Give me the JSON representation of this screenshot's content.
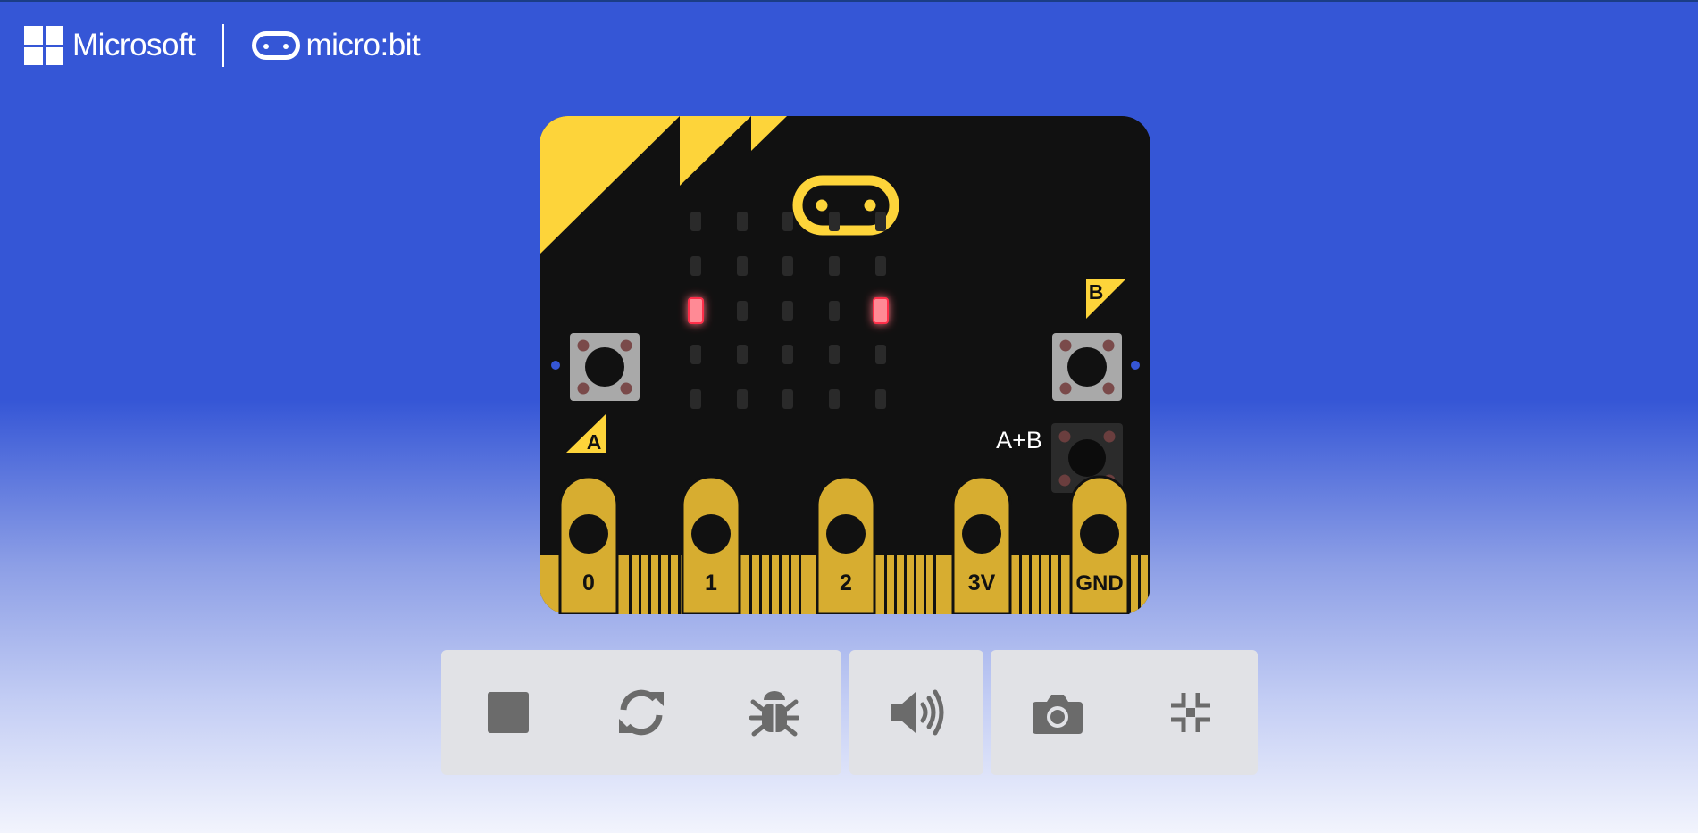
{
  "header": {
    "brand": "Microsoft",
    "product": "micro:bit"
  },
  "board": {
    "button_a_label": "A",
    "button_b_label": "B",
    "button_ab_label": "A+B",
    "pins": [
      "0",
      "1",
      "2",
      "3V",
      "GND"
    ],
    "led_matrix": [
      [
        0,
        0,
        0,
        0,
        0
      ],
      [
        0,
        0,
        0,
        0,
        0
      ],
      [
        1,
        0,
        0,
        0,
        1
      ],
      [
        0,
        0,
        0,
        0,
        0
      ],
      [
        0,
        0,
        0,
        0,
        0
      ]
    ]
  },
  "toolbar": {
    "buttons": [
      {
        "name": "stop",
        "icon": "stop-icon"
      },
      {
        "name": "restart",
        "icon": "restart-icon"
      },
      {
        "name": "debug",
        "icon": "bug-icon"
      },
      {
        "name": "mute",
        "icon": "speaker-icon"
      },
      {
        "name": "screenshot",
        "icon": "camera-icon"
      },
      {
        "name": "fullscreen",
        "icon": "exit-fullscreen-icon"
      }
    ]
  },
  "colors": {
    "background": "#3556d6",
    "board": "#111111",
    "accent_yellow": "#fdd43a",
    "pin_gold": "#d7ad30",
    "led_on": "#ff4d62",
    "led_off": "#2a2a2a",
    "toolbar_bg": "#e1e2e6",
    "icon": "#6b6b6b"
  }
}
